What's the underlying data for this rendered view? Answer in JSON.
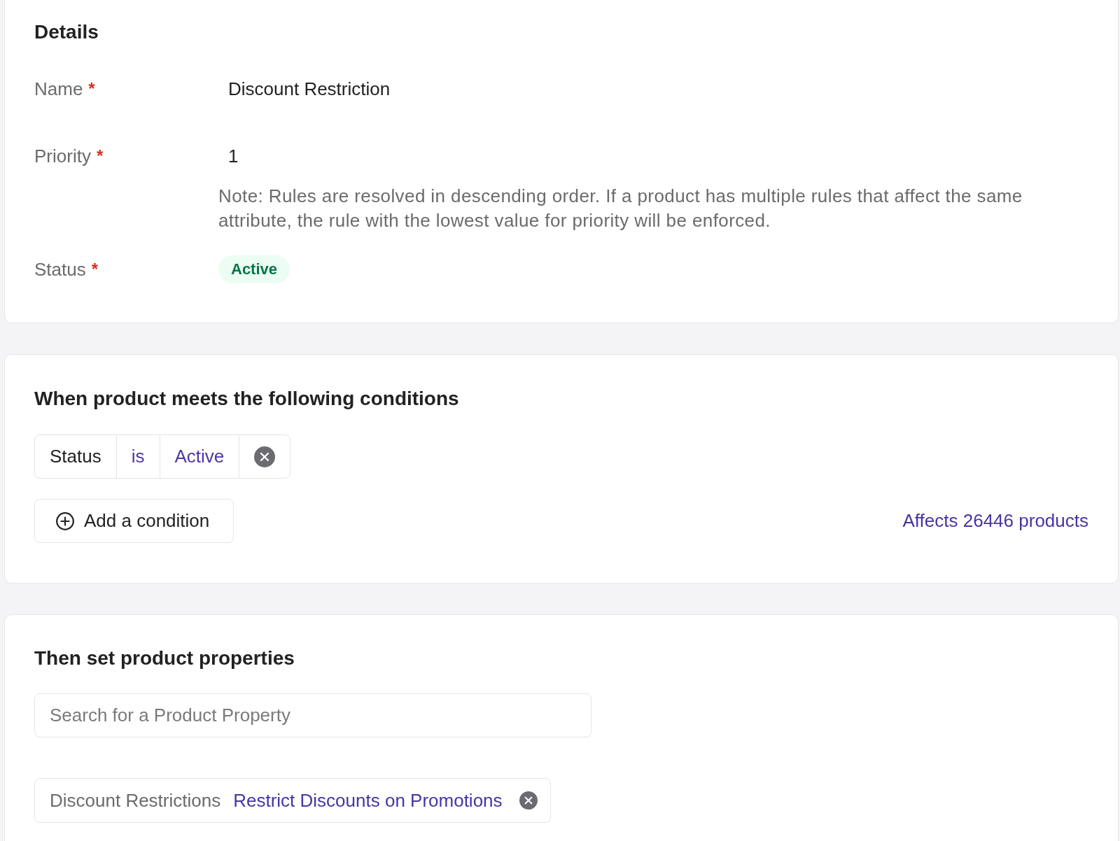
{
  "details": {
    "title": "Details",
    "fields": [
      {
        "kind": "text",
        "label": "Name",
        "required_mark": "*",
        "value": "Discount Restriction"
      },
      {
        "kind": "text",
        "label": "Priority",
        "required_mark": "*",
        "value": "1",
        "note": "Note: Rules are resolved in descending order. If a product has multiple rules that affect the same attribute, the rule with the lowest value for priority will be enforced."
      },
      {
        "kind": "badge",
        "label": "Status",
        "required_mark": "*",
        "value": "Active"
      }
    ]
  },
  "conditions": {
    "title": "When product meets the following conditions",
    "rules": [
      {
        "field": "Status",
        "operator": "is",
        "value": "Active"
      }
    ],
    "add_button": "Add a condition",
    "affects": "Affects 26446 products"
  },
  "properties": {
    "title": "Then set product properties",
    "search": {
      "placeholder": "Search for a Product Property"
    },
    "assignments": [
      {
        "property": "Discount Restrictions",
        "value": "Restrict Discounts on Promotions"
      }
    ]
  }
}
